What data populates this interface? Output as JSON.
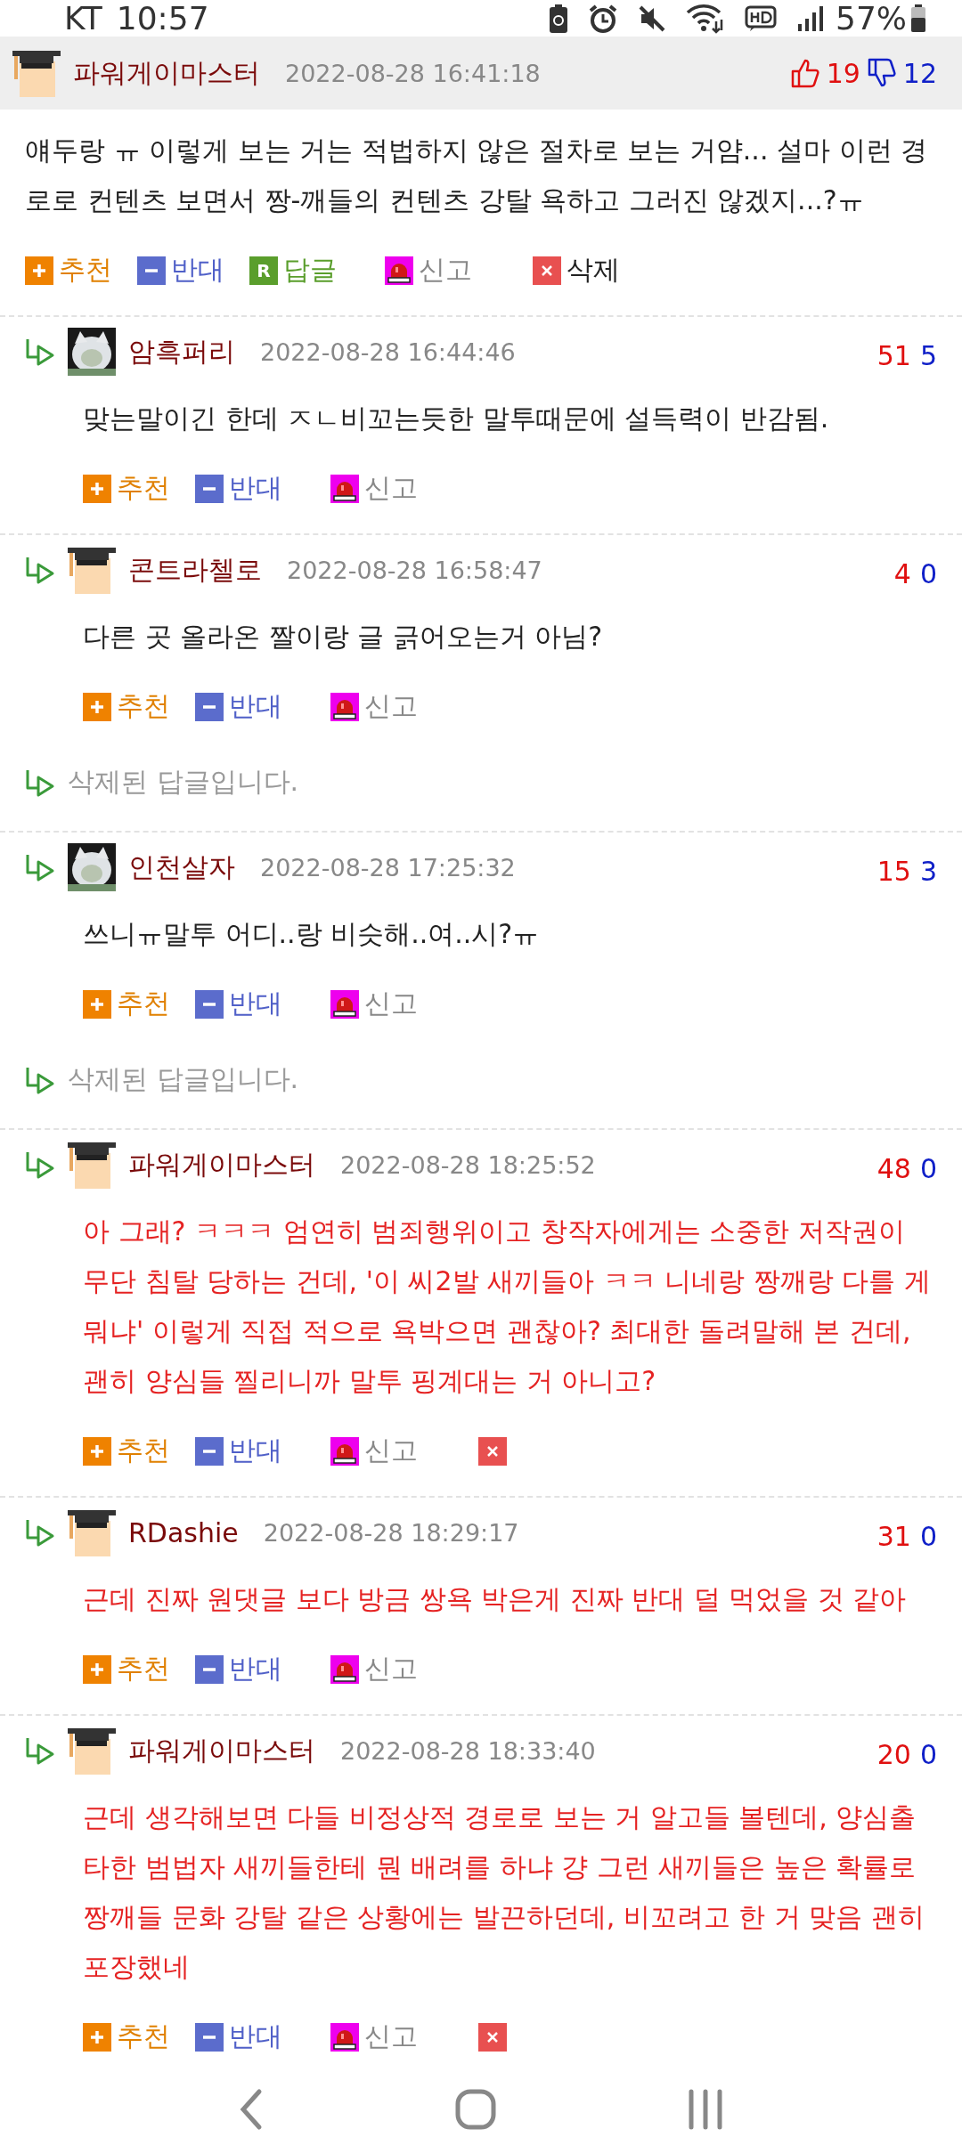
{
  "status_bar": {
    "carrier": "KT",
    "time": "10:57",
    "battery": "57%"
  },
  "comments": [
    {
      "kind": "post",
      "avatar": {
        "kind": "graduate"
      },
      "author": "파워게이마스터",
      "time": "2022-08-28 16:41:18",
      "up": "19",
      "down": "12",
      "color": "#222222",
      "text": "얘두랑 ㅠ 이렇게 보는 거는 적법하지 않은 절차로 보는 거얌... 설마 이런 경로로 컨텐츠 보면서 짱-깨들의 컨텐츠 강탈 욕하고 그러진 않겠지...?ㅠ",
      "actions": [
        {
          "kind": "up",
          "label": "추천"
        },
        {
          "kind": "down",
          "label": "반대"
        },
        {
          "kind": "reply",
          "icon": "R",
          "label": "답글"
        },
        {
          "kind": "report",
          "label": "신고"
        },
        {
          "kind": "delete",
          "label": "삭제"
        }
      ]
    },
    {
      "kind": "reply",
      "avatar": {
        "kind": "picture"
      },
      "author": "암흑퍼리",
      "time": "2022-08-28 16:44:46",
      "up": "51",
      "down": "5",
      "color": "#222222",
      "text": "맞는말이긴 한데 ㅈㄴ비꼬는듯한 말투때문에 설득력이 반감됨.",
      "actions": [
        {
          "kind": "up",
          "label": "추천"
        },
        {
          "kind": "down",
          "label": "반대"
        },
        {
          "kind": "report",
          "label": "신고"
        }
      ]
    },
    {
      "kind": "reply",
      "avatar": {
        "kind": "graduate"
      },
      "author": "콘트라첼로",
      "time": "2022-08-28 16:58:47",
      "up": "4",
      "down": "0",
      "color": "#222222",
      "text": "다른 곳 올라온 짤이랑 글 긁어오는거 아님?",
      "actions": [
        {
          "kind": "up",
          "label": "추천"
        },
        {
          "kind": "down",
          "label": "반대"
        },
        {
          "kind": "report",
          "label": "신고"
        }
      ]
    },
    {
      "kind": "deleted",
      "text": "삭제된 답글입니다."
    },
    {
      "kind": "reply",
      "avatar": {
        "kind": "picture"
      },
      "author": "인천살자",
      "time": "2022-08-28 17:25:32",
      "up": "15",
      "down": "3",
      "color": "#222222",
      "text": "쓰니ㅠ말투 어디..랑 비슷해..여..시?ㅠ",
      "actions": [
        {
          "kind": "up",
          "label": "추천"
        },
        {
          "kind": "down",
          "label": "반대"
        },
        {
          "kind": "report",
          "label": "신고"
        }
      ]
    },
    {
      "kind": "deleted",
      "text": "삭제된 답글입니다."
    },
    {
      "kind": "reply",
      "avatar": {
        "kind": "graduate"
      },
      "author": "파워게이마스터",
      "time": "2022-08-28 18:25:52",
      "up": "48",
      "down": "0",
      "color": "#e52222",
      "text": "아 그래? ㅋㅋㅋ 엄연히 범죄행위이고 창작자에게는 소중한 저작권이 무단 침탈 당하는 건데, '이 씨2발 새끼들아 ㅋㅋ 니네랑 짱깨랑 다를 게 뭐냐' 이렇게 직접 적으로 욕박으면 괜찮아? 최대한 돌려말해 본 건데, 괜히 양심들 찔리니까 말투 핑계대는 거 아니고?",
      "actions": [
        {
          "kind": "up",
          "label": "추천"
        },
        {
          "kind": "down",
          "label": "반대"
        },
        {
          "kind": "report",
          "label": "신고"
        },
        {
          "kind": "delete"
        }
      ]
    },
    {
      "kind": "reply",
      "avatar": {
        "kind": "graduate"
      },
      "author": "RDashie",
      "time": "2022-08-28 18:29:17",
      "up": "31",
      "down": "0",
      "color": "#e52222",
      "text": "근데 진짜 원댓글 보다 방금 쌍욕 박은게 진짜 반대 덜 먹었을 것 같아",
      "actions": [
        {
          "kind": "up",
          "label": "추천"
        },
        {
          "kind": "down",
          "label": "반대"
        },
        {
          "kind": "report",
          "label": "신고"
        }
      ]
    },
    {
      "kind": "reply",
      "avatar": {
        "kind": "graduate"
      },
      "author": "파워게이마스터",
      "time": "2022-08-28 18:33:40",
      "up": "20",
      "down": "0",
      "color": "#e52222",
      "text": "근데 생각해보면 다들 비정상적 경로로 보는 거 알고들 볼텐데, 양심출타한 범법자 새끼들한테 뭔 배려를 하냐 걍 그런 새끼들은 높은 확률로 짱깨들 문화 강탈 같은 상황에는 발끈하던데, 비꼬려고 한 거 맞음 괜히 포장했네",
      "actions": [
        {
          "kind": "up",
          "label": "추천"
        },
        {
          "kind": "down",
          "label": "반대"
        },
        {
          "kind": "report",
          "label": "신고"
        },
        {
          "kind": "delete"
        }
      ]
    }
  ]
}
